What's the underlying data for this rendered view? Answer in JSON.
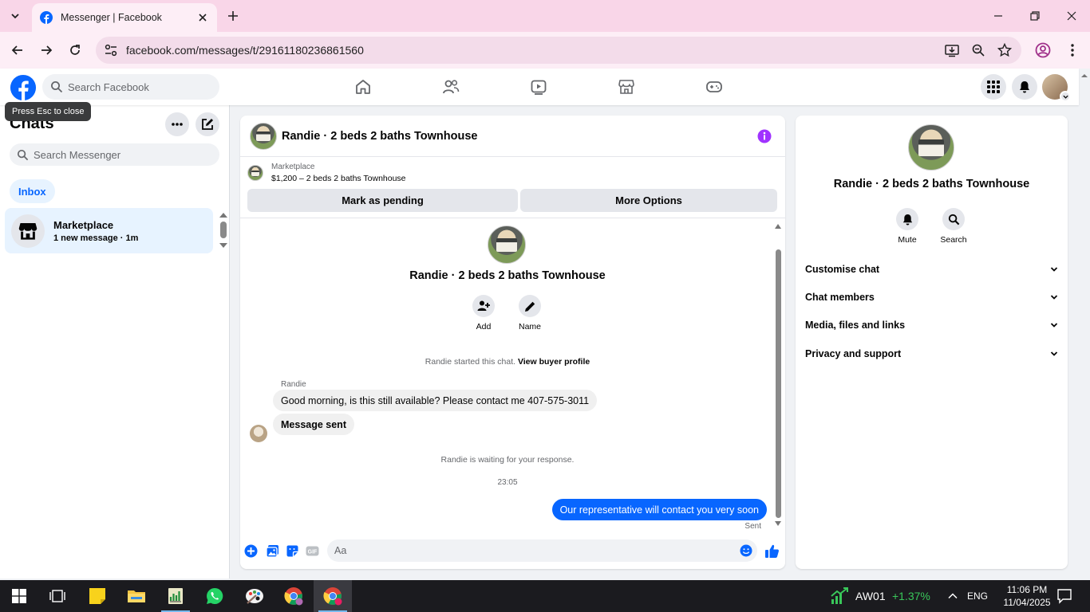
{
  "browser": {
    "tab_title": "Messenger | Facebook",
    "url": "facebook.com/messages/t/29161180236861560"
  },
  "fb": {
    "search_placeholder": "Search Facebook",
    "tooltip": "Press Esc to close"
  },
  "sidebar": {
    "title": "Chats",
    "search_placeholder": "Search Messenger",
    "filter_label": "Inbox",
    "chats": [
      {
        "name": "Marketplace",
        "preview": "1 new message · 1m"
      }
    ]
  },
  "conversation": {
    "title": "Randie · 2 beds 2 baths Townhouse",
    "marketplace_label": "Marketplace",
    "listing": "$1,200 – 2 beds 2 baths Townhouse",
    "mark_pending_label": "Mark as pending",
    "more_options_label": "More Options",
    "add_label": "Add",
    "name_label": "Name",
    "started_text": "Randie started this chat.",
    "view_profile_label": "View buyer profile",
    "sender_name": "Randie",
    "messages_in": [
      "Good morning, is this still available? Please contact me 407-575-3011",
      "Message sent"
    ],
    "waiting_text": "Randie is waiting for your response.",
    "timestamp": "23:05",
    "message_out": "Our representative will contact you very soon",
    "sent_label": "Sent",
    "composer_placeholder": "Aa"
  },
  "info_panel": {
    "title": "Randie · 2 beds 2 baths Townhouse",
    "mute_label": "Mute",
    "search_label": "Search",
    "sections": [
      "Customise chat",
      "Chat members",
      "Media, files and links",
      "Privacy and support"
    ]
  },
  "taskbar": {
    "ticker_name": "AW01",
    "ticker_change": "+1.37%",
    "language": "ENG",
    "time": "11:06 PM",
    "date": "11/04/2025"
  },
  "colors": {
    "accent": "#0866ff",
    "info_icon": "#a033ff",
    "tab_strip": "#f9d6e8",
    "ticker_up": "#39c75a"
  }
}
